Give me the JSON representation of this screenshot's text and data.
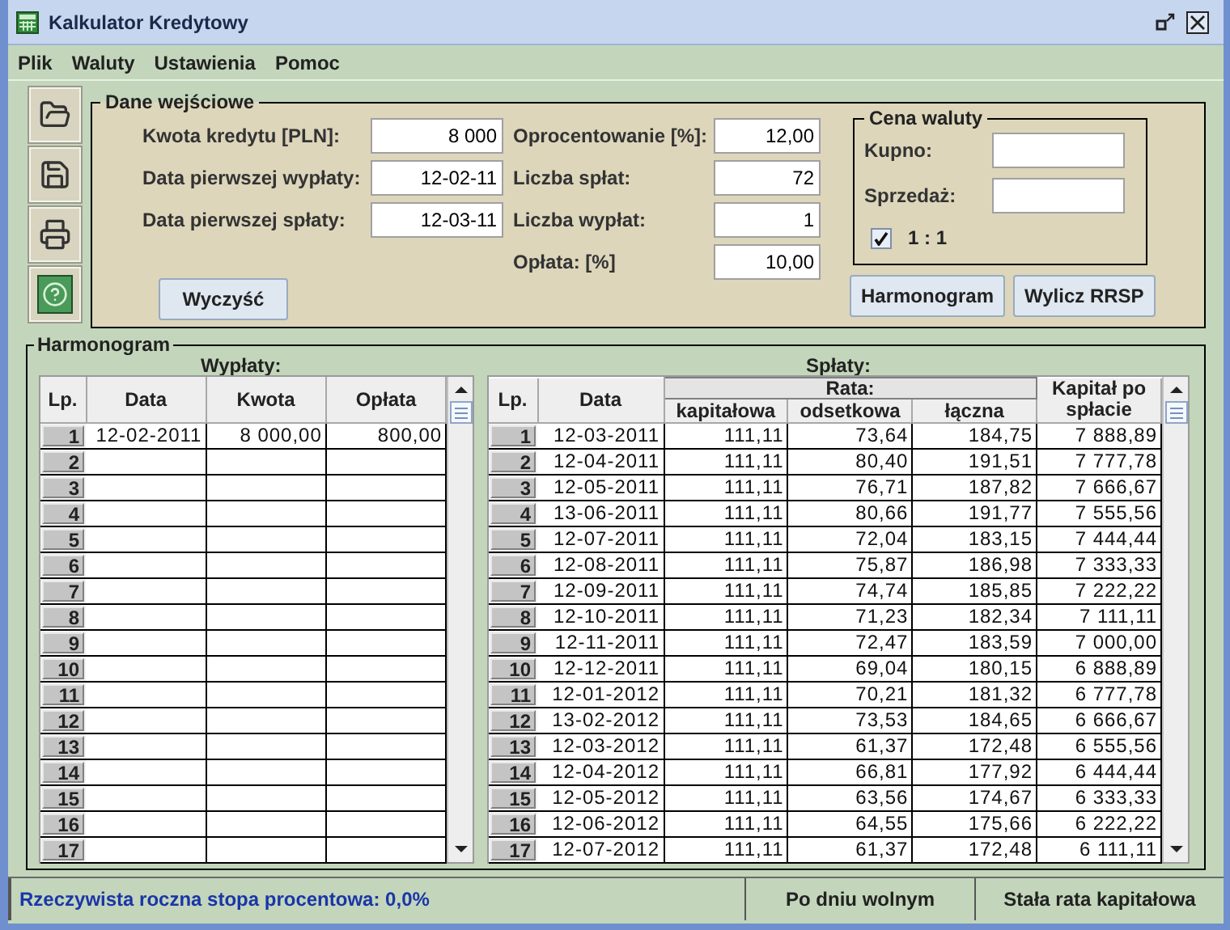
{
  "window": {
    "title": "Kalkulator Kredytowy"
  },
  "menu": [
    "Plik",
    "Waluty",
    "Ustawienia",
    "Pomoc"
  ],
  "input_panel": {
    "title": "Dane wejściowe",
    "fields_left": [
      {
        "label": "Kwota kredytu [PLN]:",
        "value": "8 000"
      },
      {
        "label": "Data pierwszej wypłaty:",
        "value": "12-02-11"
      },
      {
        "label": "Data pierwszej spłaty:",
        "value": "12-03-11"
      }
    ],
    "fields_right": [
      {
        "label": "Oprocentowanie [%]:",
        "value": "12,00"
      },
      {
        "label": "Liczba spłat:",
        "value": "72"
      },
      {
        "label": "Liczba wypłat:",
        "value": "1"
      },
      {
        "label": "Opłata: [%]",
        "value": "10,00"
      }
    ],
    "clear_button": "Wyczyść",
    "currency": {
      "title": "Cena waluty",
      "fields": [
        {
          "label": "Kupno:"
        },
        {
          "label": "Sprzedaż:"
        }
      ],
      "checkbox": {
        "label": "1 : 1",
        "checked": true
      }
    },
    "buttons": [
      "Harmonogram",
      "Wylicz RRSP"
    ]
  },
  "schedule": {
    "title": "Harmonogram",
    "payouts": {
      "title": "Wypłaty:",
      "columns": [
        "Lp.",
        "Data",
        "Kwota",
        "Opłata"
      ],
      "rows": [
        {
          "cells": [
            "1",
            "12-02-2011",
            "8 000,00",
            "800,00"
          ]
        },
        {
          "cells": [
            "2"
          ]
        },
        {
          "cells": [
            "3"
          ]
        },
        {
          "cells": [
            "4"
          ]
        },
        {
          "cells": [
            "5"
          ]
        },
        {
          "cells": [
            "6"
          ]
        },
        {
          "cells": [
            "7"
          ]
        },
        {
          "cells": [
            "8"
          ]
        },
        {
          "cells": [
            "9"
          ]
        },
        {
          "cells": [
            "10"
          ]
        },
        {
          "cells": [
            "11"
          ]
        },
        {
          "cells": [
            "12"
          ]
        },
        {
          "cells": [
            "13"
          ]
        },
        {
          "cells": [
            "14"
          ]
        },
        {
          "cells": [
            "15"
          ]
        },
        {
          "cells": [
            "16"
          ]
        },
        {
          "cells": [
            "17"
          ]
        }
      ]
    },
    "repayments": {
      "title": "Spłaty:",
      "column_group": {
        "label": "Rata:"
      },
      "columns": [
        "Lp.",
        "Data",
        "kapitałowa",
        "odsetkowa",
        "łączna",
        "Kapitał po spłacie"
      ],
      "rows": [
        {
          "cells": [
            "1",
            "12-03-2011",
            "111,11",
            "73,64",
            "184,75",
            "7 888,89"
          ]
        },
        {
          "cells": [
            "2",
            "12-04-2011",
            "111,11",
            "80,40",
            "191,51",
            "7 777,78"
          ]
        },
        {
          "cells": [
            "3",
            "12-05-2011",
            "111,11",
            "76,71",
            "187,82",
            "7 666,67"
          ]
        },
        {
          "cells": [
            "4",
            "13-06-2011",
            "111,11",
            "80,66",
            "191,77",
            "7 555,56"
          ]
        },
        {
          "cells": [
            "5",
            "12-07-2011",
            "111,11",
            "72,04",
            "183,15",
            "7 444,44"
          ]
        },
        {
          "cells": [
            "6",
            "12-08-2011",
            "111,11",
            "75,87",
            "186,98",
            "7 333,33"
          ]
        },
        {
          "cells": [
            "7",
            "12-09-2011",
            "111,11",
            "74,74",
            "185,85",
            "7 222,22"
          ]
        },
        {
          "cells": [
            "8",
            "12-10-2011",
            "111,11",
            "71,23",
            "182,34",
            "7 111,11"
          ]
        },
        {
          "cells": [
            "9",
            "12-11-2011",
            "111,11",
            "72,47",
            "183,59",
            "7 000,00"
          ]
        },
        {
          "cells": [
            "10",
            "12-12-2011",
            "111,11",
            "69,04",
            "180,15",
            "6 888,89"
          ]
        },
        {
          "cells": [
            "11",
            "12-01-2012",
            "111,11",
            "70,21",
            "181,32",
            "6 777,78"
          ]
        },
        {
          "cells": [
            "12",
            "13-02-2012",
            "111,11",
            "73,53",
            "184,65",
            "6 666,67"
          ]
        },
        {
          "cells": [
            "13",
            "12-03-2012",
            "111,11",
            "61,37",
            "172,48",
            "6 555,56"
          ]
        },
        {
          "cells": [
            "14",
            "12-04-2012",
            "111,11",
            "66,81",
            "177,92",
            "6 444,44"
          ]
        },
        {
          "cells": [
            "15",
            "12-05-2012",
            "111,11",
            "63,56",
            "174,67",
            "6 333,33"
          ]
        },
        {
          "cells": [
            "16",
            "12-06-2012",
            "111,11",
            "64,55",
            "175,66",
            "6 222,22"
          ]
        },
        {
          "cells": [
            "17",
            "12-07-2012",
            "111,11",
            "61,37",
            "172,48",
            "6 111,11"
          ]
        }
      ]
    }
  },
  "status_bar": [
    "Rzeczywista roczna stopa procentowa: 0,0%",
    "Po dniu wolnym",
    "Stała rata kapitałowa"
  ]
}
